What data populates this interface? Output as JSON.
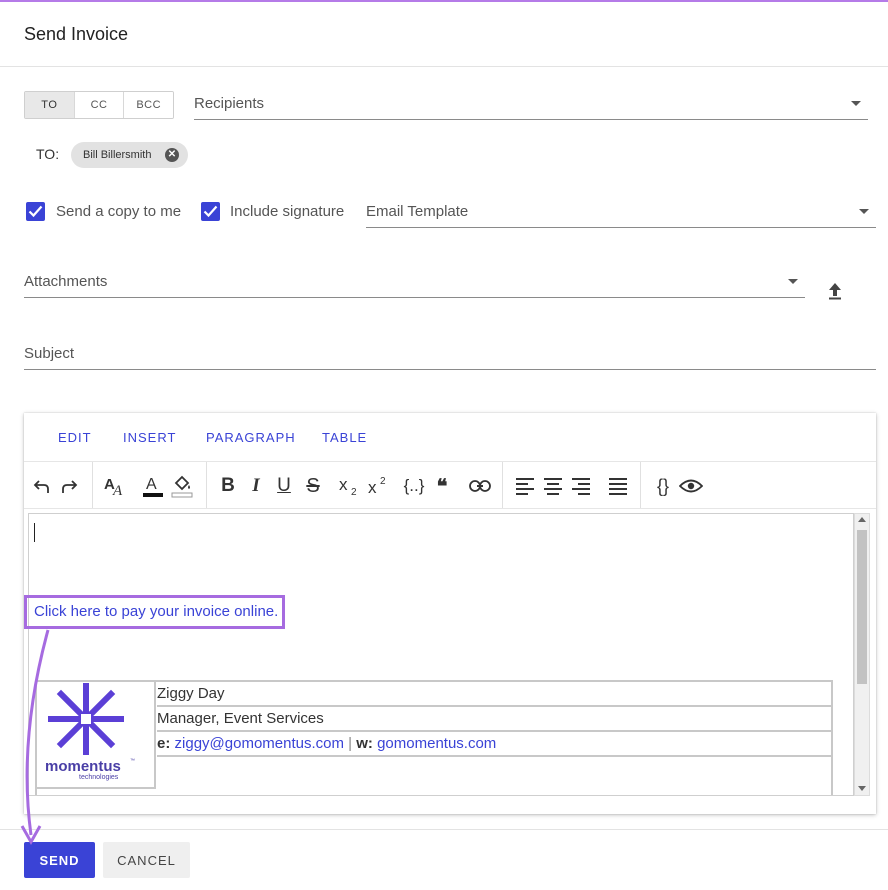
{
  "dialog": {
    "title": "Send Invoice"
  },
  "recipient_mode": {
    "options": [
      "TO",
      "CC",
      "BCC"
    ],
    "selected": "TO"
  },
  "recipients": {
    "placeholder": "Recipients"
  },
  "to_line": {
    "label": "TO:",
    "chips": [
      "Bill Billersmith"
    ]
  },
  "options": {
    "send_copy": {
      "label": "Send a copy to me",
      "checked": true
    },
    "include_signature": {
      "label": "Include signature",
      "checked": true
    }
  },
  "email_template": {
    "placeholder": "Email Template"
  },
  "attachments": {
    "placeholder": "Attachments"
  },
  "subject": {
    "placeholder": "Subject"
  },
  "editor": {
    "menu": [
      "EDIT",
      "INSERT",
      "PARAGRAPH",
      "TABLE"
    ],
    "toolbar_icons": [
      "undo-icon",
      "redo-icon",
      "font-size-icon",
      "text-color-icon",
      "highlight-color-icon",
      "bold-icon",
      "italic-icon",
      "underline-icon",
      "strikethrough-icon",
      "subscript-icon",
      "superscript-icon",
      "merge-field-icon",
      "blockquote-icon",
      "link-icon",
      "align-left-icon",
      "align-center-icon",
      "align-right-icon",
      "justify-icon",
      "source-code-icon",
      "preview-icon"
    ],
    "pay_link": "Click here to pay your invoice online.",
    "signature": {
      "name": "Ziggy Day",
      "title": "Manager, Event Services",
      "email_prefix": "e:",
      "email": "ziggy@gomomentus.com",
      "separator": "|",
      "web_prefix": "w:",
      "website": "gomomentus.com",
      "logo_name": "momentus",
      "logo_sub": "technologies",
      "logo_tm": "™"
    }
  },
  "actions": {
    "send": "SEND",
    "cancel": "CANCEL"
  },
  "colors": {
    "accent": "#3a43d6",
    "annotation": "#a66be0"
  }
}
